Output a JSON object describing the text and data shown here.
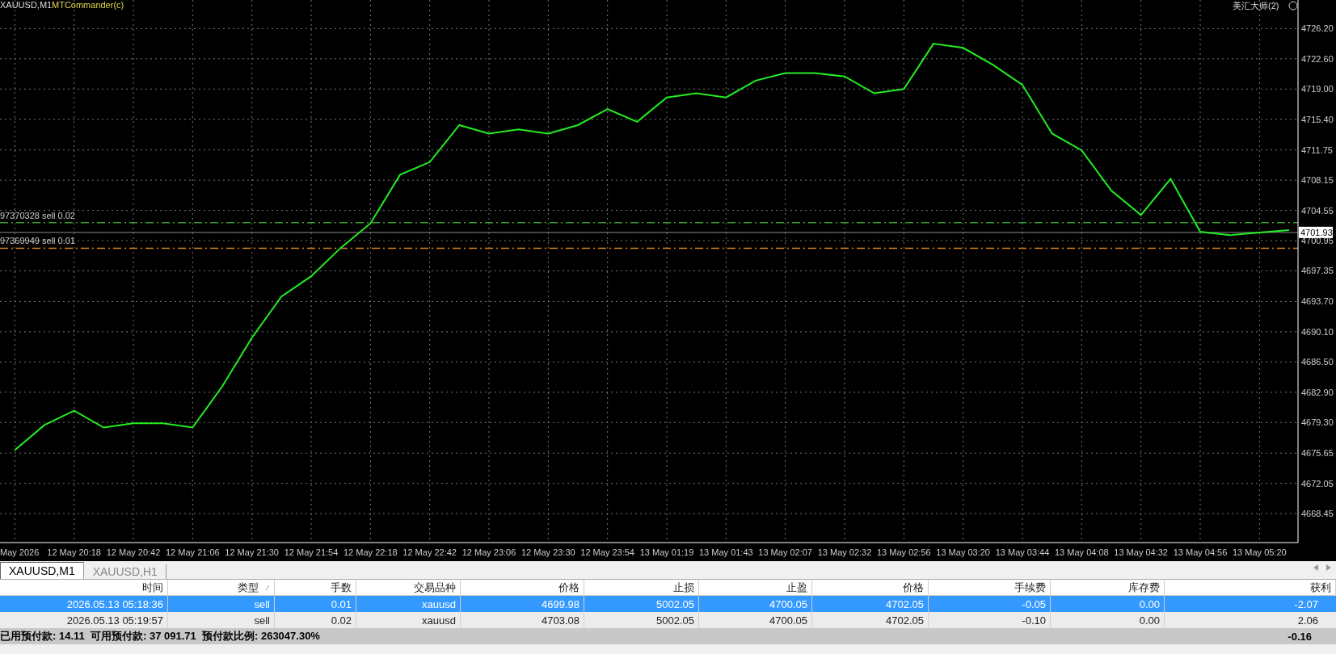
{
  "chart": {
    "symbol_label": "XAUUSD,M1",
    "expert_label": "MTCommander(c)",
    "account_label": "美汇大师(2)",
    "chart_data": {
      "type": "line",
      "grid": true,
      "ref_lines": [
        {
          "axis": "y",
          "value": 4703.08,
          "label": "97370328 sell 0.02",
          "color": "#3c9a3c"
        },
        {
          "axis": "y",
          "value": 4700.05,
          "label": "97369949 sell 0.01",
          "color": "#d9822b"
        },
        {
          "axis": "y",
          "value": 4701.93,
          "label": "4701.93",
          "color": "#888888"
        }
      ],
      "categories": [
        "May 2026",
        null,
        "12 May 20:18",
        null,
        "12 May 20:42",
        null,
        "12 May 21:06",
        null,
        "12 May 21:30",
        null,
        "12 May 21:54",
        null,
        "12 May 22:18",
        null,
        "12 May 22:42",
        null,
        "12 May 23:06",
        null,
        "12 May 23:30",
        null,
        "12 May 23:54",
        null,
        "13 May 01:19",
        null,
        "13 May 01:43",
        null,
        "13 May 02:07",
        null,
        "13 May 02:32",
        null,
        "13 May 02:56",
        null,
        "13 May 03:20",
        null,
        "13 May 03:44",
        null,
        "13 May 04:08",
        null,
        "13 May 04:32",
        null,
        "13 May 04:56",
        null,
        "13 May 05:20",
        null
      ],
      "series": [
        {
          "color": "#22ee22",
          "values": [
            4676.0,
            4679.0,
            4680.7,
            4678.7,
            4679.2,
            4679.2,
            4678.7,
            4683.6,
            4689.4,
            4694.3,
            4696.7,
            4700.1,
            4703.0,
            4708.8,
            4710.3,
            4714.7,
            4713.7,
            4714.2,
            4713.7,
            4714.7,
            4716.6,
            4715.1,
            4718.0,
            4718.5,
            4718.0,
            4720.0,
            4720.9,
            4720.9,
            4720.5,
            4718.5,
            4719.0,
            4724.4,
            4723.9,
            4721.9,
            4719.5,
            4713.7,
            4711.7,
            4706.9,
            4704.0,
            4708.3,
            4702.0,
            4701.6,
            4701.9,
            4702.2
          ]
        }
      ],
      "ylim": [
        4665.0,
        4729.6
      ],
      "yticks": [
        {
          "value": 4726.2,
          "label": "4726.20"
        },
        {
          "value": 4722.6,
          "label": "4722.60"
        },
        {
          "value": 4719.0,
          "label": "4719.00"
        },
        {
          "value": 4715.4,
          "label": "4715.40"
        },
        {
          "value": 4711.75,
          "label": "4711.75"
        },
        {
          "value": 4708.15,
          "label": "4708.15"
        },
        {
          "value": 4704.55,
          "label": "4704.55"
        },
        {
          "value": 4700.95,
          "label": "4700.95"
        },
        {
          "value": 4697.35,
          "label": "4697.35"
        },
        {
          "value": 4693.7,
          "label": "4693.70"
        },
        {
          "value": 4690.1,
          "label": "4690.10"
        },
        {
          "value": 4686.5,
          "label": "4686.50"
        },
        {
          "value": 4682.9,
          "label": "4682.90"
        },
        {
          "value": 4679.3,
          "label": "4679.30"
        },
        {
          "value": 4675.65,
          "label": "4675.65"
        },
        {
          "value": 4672.05,
          "label": "4672.05"
        },
        {
          "value": 4668.45,
          "label": "4668.45"
        }
      ]
    }
  },
  "tabs": [
    {
      "label": "XAUUSD,M1",
      "selected": true
    },
    {
      "label": "XAUUSD,H1",
      "selected": false
    }
  ],
  "table": {
    "columns": [
      {
        "label": "时间",
        "sorted": false
      },
      {
        "label": "类型",
        "sorted": true
      },
      {
        "label": "手数",
        "sorted": false
      },
      {
        "label": "交易品种",
        "sorted": false
      },
      {
        "label": "价格",
        "sorted": false
      },
      {
        "label": "止损",
        "sorted": false
      },
      {
        "label": "止盈",
        "sorted": false
      },
      {
        "label": "价格",
        "sorted": false
      },
      {
        "label": "手续费",
        "sorted": false
      },
      {
        "label": "库存费",
        "sorted": false
      },
      {
        "label": "获利",
        "sorted": false
      }
    ],
    "rows": [
      {
        "selected": true,
        "cells": [
          "2026.05.13 05:18:36",
          "sell",
          "0.01",
          "xauusd",
          "4699.98",
          "5002.05",
          "4700.05",
          "4702.05",
          "-0.05",
          "0.00",
          "-2.07"
        ]
      },
      {
        "selected": false,
        "cells": [
          "2026.05.13 05:19:57",
          "sell",
          "0.02",
          "xauusd",
          "4703.08",
          "5002.05",
          "4700.05",
          "4702.05",
          "-0.10",
          "0.00",
          "2.06"
        ]
      }
    ],
    "summary": "已用预付款: 14.11  可用预付款: 37 091.71  预付款比例: 263047.30%",
    "total": "-0.16"
  }
}
